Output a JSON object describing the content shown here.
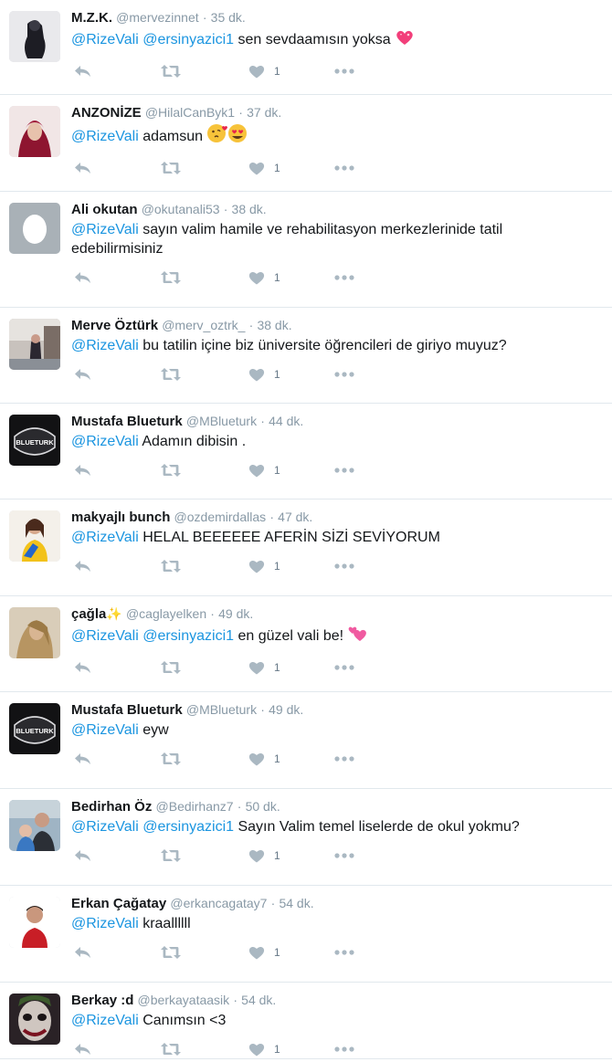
{
  "tweets": [
    {
      "name": "M.Z.K.",
      "handle": "@mervezinnet",
      "time": "35 dk.",
      "mentions": [
        "@RizeVali",
        "@ersinyazici1"
      ],
      "text": "sen sevdaamısın yoksa",
      "emoji": "heart-sparkle",
      "likes": "1",
      "avatar": "dark-figure"
    },
    {
      "name": "ANZONİZE",
      "handle": "@HilalCanByk1",
      "time": "37 dk.",
      "mentions": [
        "@RizeVali"
      ],
      "text": "adamsun",
      "emoji": "kiss-hearteyes",
      "likes": "1",
      "avatar": "hijab-woman"
    },
    {
      "name": "Ali okutan",
      "handle": "@okutanali53",
      "time": "38 dk.",
      "mentions": [
        "@RizeVali"
      ],
      "text": "sayın valim  hamile ve rehabilitasyon merkezlerinide  tatil edebilirmisiniz",
      "emoji": "",
      "likes": "1",
      "avatar": "egg"
    },
    {
      "name": "Merve Öztürk",
      "handle": "@merv_oztrk_",
      "time": "38 dk.",
      "mentions": [
        "@RizeVali"
      ],
      "text": "bu tatilin içine biz üniversite öğrencileri de giriyo muyuz?",
      "emoji": "",
      "likes": "1",
      "avatar": "street-woman"
    },
    {
      "name": "Mustafa Blueturk",
      "handle": "@MBlueturk",
      "time": "44 dk.",
      "mentions": [
        "@RizeVali"
      ],
      "text": "Adamın dibisin .",
      "emoji": "",
      "likes": "1",
      "avatar": "blueturk-logo"
    },
    {
      "name": "makyajlı bunch",
      "handle": "@ozdemirdallas",
      "time": "47 dk.",
      "mentions": [
        "@RizeVali"
      ],
      "text": "HELAL BEEEEEE AFERİN SİZİ SEVİYORUM",
      "emoji": "",
      "likes": "1",
      "avatar": "colorful-girl"
    },
    {
      "name": "çağla",
      "name_suffix": "✨",
      "handle": "@caglayelken",
      "time": "49 dk.",
      "mentions": [
        "@RizeVali",
        "@ersinyazici1"
      ],
      "text": "en güzel vali be!",
      "emoji": "two-hearts",
      "likes": "1",
      "avatar": "blonde-girl"
    },
    {
      "name": "Mustafa Blueturk",
      "handle": "@MBlueturk",
      "time": "49 dk.",
      "mentions": [
        "@RizeVali"
      ],
      "text": "eyw",
      "emoji": "",
      "likes": "1",
      "avatar": "blueturk-logo"
    },
    {
      "name": "Bedirhan Öz",
      "handle": "@Bedirhanz7",
      "time": "50 dk.",
      "mentions": [
        "@RizeVali",
        "@ersinyazici1"
      ],
      "text": "Sayın Valim temel liselerde de okul yokmu?",
      "emoji": "",
      "likes": "1",
      "avatar": "man-child"
    },
    {
      "name": "Erkan Çağatay",
      "handle": "@erkancagatay7",
      "time": "54 dk.",
      "mentions": [
        "@RizeVali"
      ],
      "text": "kraallllll",
      "emoji": "",
      "likes": "1",
      "avatar": "red-shirt-man"
    },
    {
      "name": "Berkay :d",
      "handle": "@berkayataasik",
      "time": "54 dk.",
      "mentions": [
        "@RizeVali"
      ],
      "text": "Canımsın <3",
      "emoji": "",
      "likes": "1",
      "avatar": "joker"
    }
  ],
  "colors": {
    "mention": "#1b95e0",
    "meta": "#8899a6",
    "icon": "#aab8c2",
    "divider": "#e1e8ed"
  },
  "blueturk_label": "BLUETURK"
}
